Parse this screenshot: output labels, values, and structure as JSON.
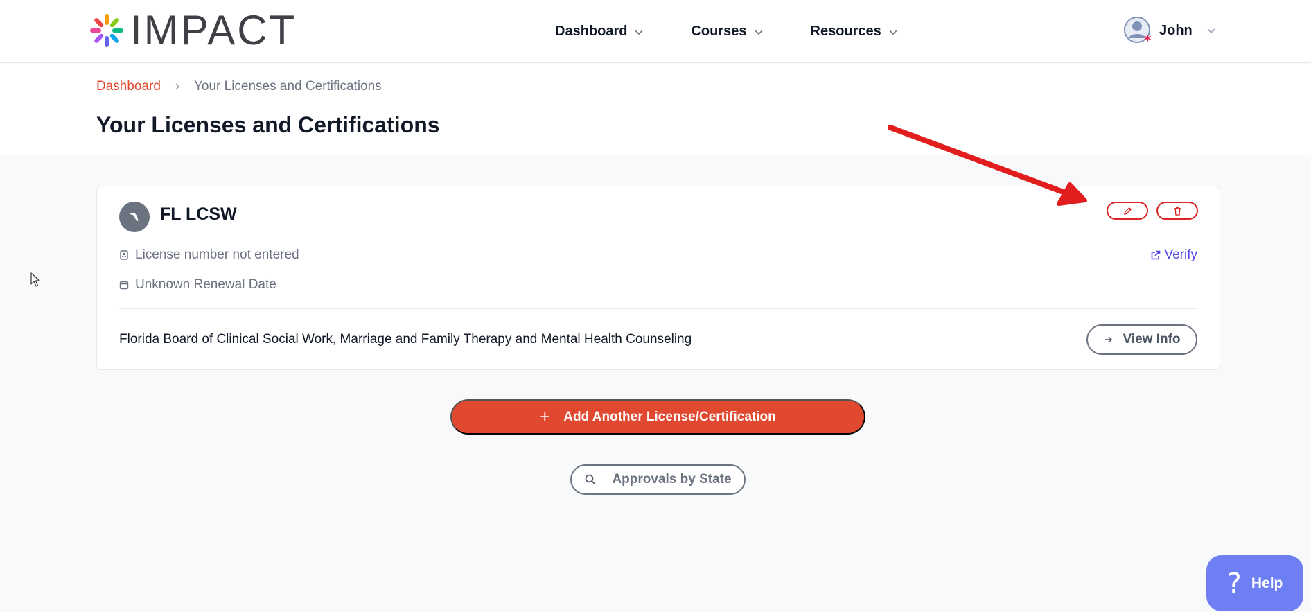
{
  "brand": {
    "name": "IMPACT",
    "accent": "#e0492f"
  },
  "nav": {
    "items": [
      {
        "label": "Dashboard"
      },
      {
        "label": "Courses"
      },
      {
        "label": "Resources"
      }
    ]
  },
  "user": {
    "name": "John"
  },
  "breadcrumb": {
    "home": "Dashboard",
    "current": "Your Licenses and Certifications"
  },
  "page": {
    "title": "Your Licenses and Certifications"
  },
  "license": {
    "title": "FL LCSW",
    "state_icon": "florida-state-icon",
    "number_text": "License number not entered",
    "renewal_text": "Unknown Renewal Date",
    "verify_label": "Verify",
    "board": "Florida Board of Clinical Social Work, Marriage and Family Therapy and Mental Health Counseling",
    "view_info_label": "View Info"
  },
  "actions": {
    "add_label": "Add Another License/Certification",
    "add_icon": "+",
    "approvals_label": "Approvals by State"
  },
  "help": {
    "icon": "?",
    "label": "Help"
  },
  "colors": {
    "danger": "#dc2626",
    "link": "#4f46e5",
    "help_bg": "#6d7ff2",
    "annotation_arrow": "#e11d1d"
  }
}
